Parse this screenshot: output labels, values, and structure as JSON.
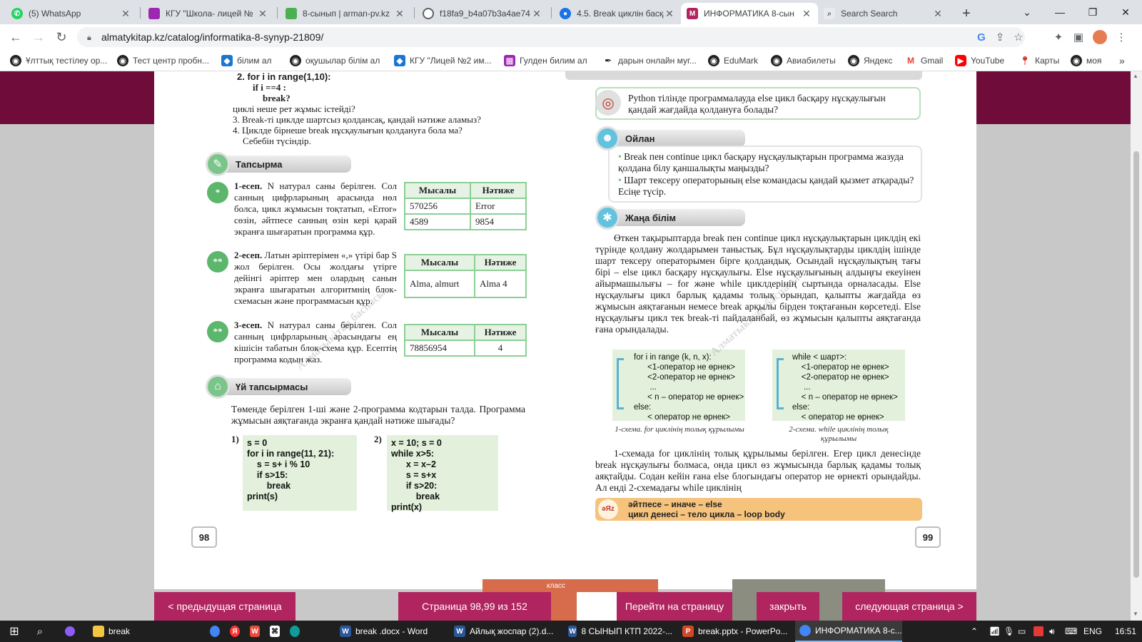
{
  "browser": {
    "tabs": [
      {
        "label": "(5) WhatsApp",
        "icon": "whatsapp-icon",
        "color": "#25d366",
        "active": false
      },
      {
        "label": "КГУ \"Школа- лицей №",
        "icon": "site-icon",
        "color": "#9c27b0",
        "active": false
      },
      {
        "label": "8-сынып | arman-pv.kz",
        "icon": "site-icon",
        "color": "#4caf50",
        "active": false
      },
      {
        "label": "f18fa9_b4a07b3a4ae74",
        "icon": "globe-icon",
        "color": "#5f6368",
        "active": false
      },
      {
        "label": "4.5. Break циклін басқа",
        "icon": "site-icon",
        "color": "#1a73e8",
        "active": false
      },
      {
        "label": "ИНФОРМАТИКА 8-сын",
        "icon": "site-icon",
        "color": "#b0245f",
        "active": true
      },
      {
        "label": "Search Search",
        "icon": "search-icon",
        "color": "#9aa0a6",
        "active": false
      }
    ],
    "new_tab": "+",
    "url": "almatykitap.kz/catalog/informatika-8-synyp-21809/",
    "bookmarks": [
      {
        "label": "Ұлттық тестілеу ор...",
        "icon": "globe-icon"
      },
      {
        "label": "Тест центр пробн...",
        "icon": "globe-icon"
      },
      {
        "label": "білим ал",
        "icon": "site-icon"
      },
      {
        "label": "оқушылар білім ал",
        "icon": "globe-icon"
      },
      {
        "label": "КГУ \"Лицей №2 им...",
        "icon": "site-icon"
      },
      {
        "label": "Гулден билим ал",
        "icon": "site-icon"
      },
      {
        "label": "дарын онлайн муг...",
        "icon": "feather-icon"
      },
      {
        "label": "EduMark",
        "icon": "globe-icon"
      },
      {
        "label": "Авиабилеты",
        "icon": "globe-icon"
      },
      {
        "label": "Яндекс",
        "icon": "globe-icon"
      },
      {
        "label": "Gmail",
        "icon": "gmail-icon"
      },
      {
        "label": "YouTube",
        "icon": "youtube-icon"
      },
      {
        "label": "Карты",
        "icon": "maps-icon"
      },
      {
        "label": "моя",
        "icon": "globe-icon"
      }
    ],
    "more_bookmarks": "»"
  },
  "book": {
    "left": {
      "questions": [
        "2. for i in range(1,10):",
        "if i ==4 :",
        "break?",
        "циклі неше рет жұмыс істейді?",
        "3. Break-ті циклде шартсыз қолдансақ, қандай нәтиже аламыз?",
        "4. Циклде бірнеше break нұсқаулығын қолдануға бола ма?",
        "Себебін түсіндір."
      ],
      "task_section": "Тапсырма",
      "tasks": [
        {
          "badge": "*",
          "text_title": "1-есеп.",
          "text_body": "N натурал саны берілген. Сол санның цифрларының арасында нөл болса, цикл жұмысын тоқтатып, «Error» сөзін, әйтпесе санның өзін кері қарай экранға шығаратын программа құр.",
          "table": {
            "headers": [
              "Мысалы",
              "Нәтиже"
            ],
            "rows": [
              [
                "570256",
                "Error"
              ],
              [
                "4589",
                "9854"
              ]
            ]
          }
        },
        {
          "badge": "**",
          "text_title": "2-есеп.",
          "text_body": "Латын әріптерімен «,» үтірі бар S жол берілген. Осы жолдағы үтірге дейінгі әріптер мен олардың санын экранға шығаратын алгоритмнің блок-схемасын және программасын құр.",
          "table": {
            "headers": [
              "Мысалы",
              "Нәтиже"
            ],
            "rows": [
              [
                "Alma, almurt",
                "Alma 4"
              ]
            ]
          }
        },
        {
          "badge": "**",
          "text_title": "3-есеп.",
          "text_body": "N натурал саны берілген. Сол санның цифрларының арасындағы ең кішісін табатын блок-схема құр. Есептің программа кодын жаз.",
          "table": {
            "headers": [
              "Мысалы",
              "Нәтиже"
            ],
            "rows": [
              [
                "78856954",
                "4"
              ]
            ]
          }
        }
      ],
      "homework_section": "Үй тапсырмасы",
      "homework_text": "Төменде берілген 1-ші және 2-программа кодтарын талда. Программа жұмысын аяқтағанда экранға қандай нәтиже шығады?",
      "program1_label": "1)",
      "program1": "s = 0\nfor i in range(11, 21):\n    s = s+ i % 10\n    if s>15:\n        break\nprint(s)",
      "program2_label": "2)",
      "program2": "x = 10; s = 0\nwhile x>5:\n      x = x–2\n      s = s+x\n      if s>20:\n          break\nprint(x)",
      "page_number": "98",
      "watermark": "Алматыкітап баспасы"
    },
    "right": {
      "question_callout": "Python тілінде программалауда else цикл басқару нұсқаулығын қандай жағдайда қолдануға болады?",
      "think_section": "Ойлан",
      "think_bullets": [
        "Break пен continue цикл басқару нұсқаулықтарын программа жазуда қолдана білу қаншалықты маңызды?",
        "Шарт тексеру операторының else командасы қандай қызмет атқарады? Есіңе түсір."
      ],
      "new_knowledge_section": "Жаңа білім",
      "paragraph": "Өткен тақырыптарда break пен continue цикл нұсқаулықтарын циклдің екі түрінде қолдану жолдарымен таныстық. Бұл нұсқаулықтарды циклдің ішінде шарт тексеру операторымен бірге қолдандық. Осындай нұсқаулықтың тағы бірі – else цикл басқару нұсқаулығы. Else нұсқаулығының алдыңғы екеуінен айырмашылығы – for және while циклдерінің сыртында орналасады. Else нұсқаулығы цикл барлық қадамы толық орындап, қалыпты жағдайда өз жұмысын аяқтағанын немесе break арқылы бірден тоқтағанын көрсетеді. Else нұсқаулығы цикл тек break-ті пайдаланбай, өз жұмысын қалыпты аяқтағанда ғана орындалады.",
      "scheme1": "for i in range (k, n, x):\n      <1-оператор не өрнек>\n      <2-оператор не өрнек>\n       ...\n      < n – оператор не өрнек>\nelse:\n      < оператор не өрнек>",
      "scheme2": "while < шарт>:\n    <1-оператор не өрнек>\n    <2-оператор не өрнек>\n     ...\n    < n – оператор не өрнек>\nelse:\n    < оператор не өрнек>",
      "caption1": "1-схема. for циклінің толық құрылымы",
      "caption2": "2-схема. while циклінің толық құрылымы",
      "paragraph2": "1-схемада for циклінің толық құрылымы берілген. Егер цикл денесінде break нұсқаулығы болмаса, онда цикл өз жұмысында барлық қадамы толық аяқтайды. Содан кейін ғана else блогындағы оператор не өрнекті орындайды. Ал енді 2-схемадағы while циклінің",
      "glossary": [
        "әйтпесе – иначе – else",
        "цикл денесі – тело цикла – loop body"
      ],
      "glossary_icon": "әЯz",
      "page_number": "99",
      "watermark": "Алматыкітап баспасы"
    }
  },
  "viewer_nav": {
    "prev": "< предыдущая страница",
    "pages": "Страница 98,99 из 152",
    "goto": "Перейти на страницу",
    "close": "закрыть",
    "next": "следующая страница >",
    "thumb_label": "класс"
  },
  "taskbar": {
    "items": [
      {
        "label": "break",
        "icon": "folder-icon",
        "color": "#f4c542"
      },
      {
        "label": "break .docx - Word",
        "icon": "word-icon",
        "color": "#2b579a"
      },
      {
        "label": "Айлық жоспар (2).d...",
        "icon": "word-icon",
        "color": "#2b579a"
      },
      {
        "label": "8 СЫНЫП КТП 2022-...",
        "icon": "word-icon",
        "color": "#2b579a"
      },
      {
        "label": "break.pptx - PowerPo...",
        "icon": "powerpoint-icon",
        "color": "#d24726"
      },
      {
        "label": "ИНФОРМАТИКА 8-с...",
        "icon": "chrome-icon",
        "color": "#4285f4"
      }
    ],
    "lang": "ENG",
    "time": "16:51"
  }
}
